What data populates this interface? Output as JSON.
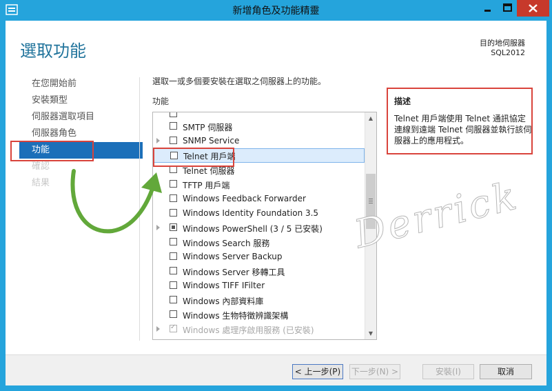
{
  "window": {
    "title": "新增角色及功能精靈"
  },
  "header": {
    "page_title": "選取功能",
    "destination_label": "目的地伺服器",
    "destination_server": "SQL2012"
  },
  "nav": {
    "items": [
      {
        "label": "在您開始前"
      },
      {
        "label": "安裝類型"
      },
      {
        "label": "伺服器選取項目"
      },
      {
        "label": "伺服器角色"
      },
      {
        "label": "功能"
      },
      {
        "label": "確認"
      },
      {
        "label": "結果"
      }
    ]
  },
  "main": {
    "instruction": "選取一或多個要安裝在選取之伺服器上的功能。",
    "features_label": "功能",
    "features": [
      {
        "label": "SMTP 伺服器"
      },
      {
        "label": "SNMP Service"
      },
      {
        "label": "Telnet 用戶端"
      },
      {
        "label": "Telnet 伺服器"
      },
      {
        "label": "TFTP 用戶端"
      },
      {
        "label": "Windows Feedback Forwarder"
      },
      {
        "label": "Windows Identity Foundation 3.5"
      },
      {
        "label": "Windows PowerShell (3 / 5 已安裝)"
      },
      {
        "label": "Windows Search 服務"
      },
      {
        "label": "Windows Server Backup"
      },
      {
        "label": "Windows Server 移轉工具"
      },
      {
        "label": "Windows TIFF IFilter"
      },
      {
        "label": "Windows 內部資料庫"
      },
      {
        "label": "Windows 生物特徵辨識架構"
      },
      {
        "label": "Windows 處理序啟用服務 (已安裝)"
      }
    ]
  },
  "description": {
    "title": "描述",
    "text": "Telnet 用戶端使用 Telnet 通訊協定連線到遠端 Telnet 伺服器並執行該伺服器上的應用程式。"
  },
  "watermark": {
    "text": "Derrick"
  },
  "footer": {
    "prev_label": "< 上一步(P)",
    "next_label": "下一步(N) >",
    "install_label": "安裝(I)",
    "cancel_label": "取消"
  },
  "colors": {
    "title_bar": "#25a4dc",
    "close_button": "#c7392b",
    "nav_active": "#1b6fb9",
    "page_title": "#21749c",
    "annotation_red": "#d9433b",
    "arrow_green": "#62a83a"
  }
}
